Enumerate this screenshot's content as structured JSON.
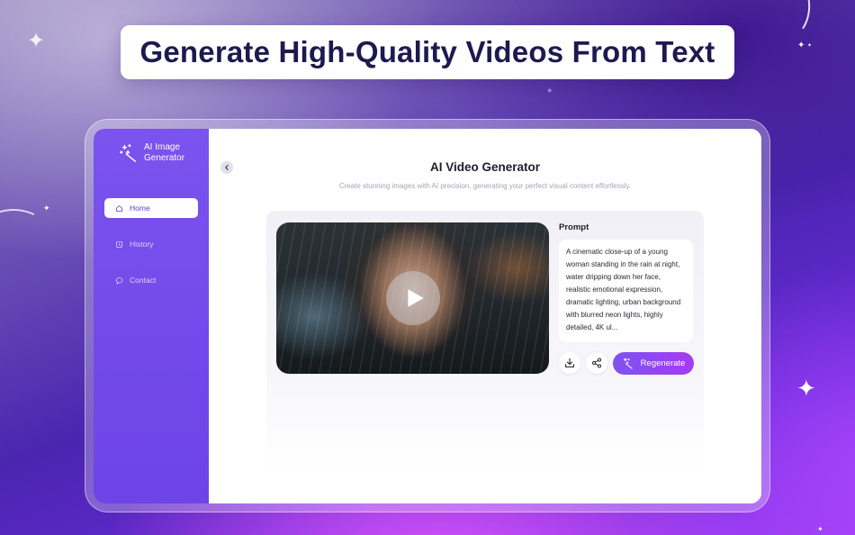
{
  "banner": {
    "headline": "Generate High-Quality Videos From Text"
  },
  "app": {
    "logo_text": "AI Image Generator",
    "title": "AI Video Generator",
    "subtitle": "Create stunning images with AI precision, generating your perfect visual content effortlessly."
  },
  "sidebar": {
    "items": [
      {
        "label": "Home",
        "icon": "home-icon",
        "active": true
      },
      {
        "label": "History",
        "icon": "history-icon",
        "active": false
      },
      {
        "label": "Contact",
        "icon": "chat-bubble-icon",
        "active": false
      }
    ]
  },
  "prompt": {
    "label": "Prompt",
    "text": "A cinematic close-up of a young woman standing in the rain at night, water dripping down her face, realistic emotional expression, dramatic lighting, urban background with blurred neon lights, highly detailed, 4K ul..."
  },
  "actions": {
    "regenerate_label": "Regenerate",
    "download_icon": "download-icon",
    "share_icon": "share-icon"
  },
  "colors": {
    "accent": "#7b53ee",
    "accent_end": "#a43cf2",
    "headline": "#1e1a4f"
  }
}
